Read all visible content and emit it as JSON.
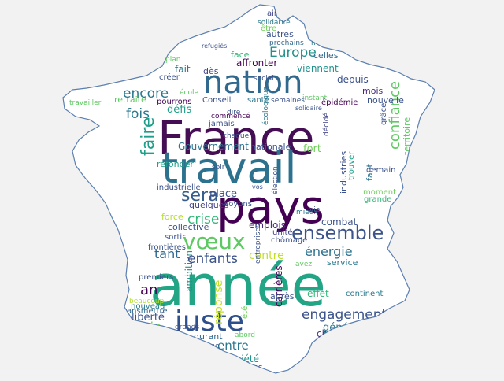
{
  "colors": {
    "background": "#f2f2f2",
    "map_fill": "#ffffff",
    "map_outline": "#5b7fb0"
  },
  "words": [
    {
      "text": "France",
      "color": "#450d54"
    },
    {
      "text": "année",
      "color": "#21a585"
    },
    {
      "text": "travail",
      "color": "#2c728e"
    },
    {
      "text": "pays",
      "color": "#440154"
    },
    {
      "text": "nation",
      "color": "#31688e"
    },
    {
      "text": "juste",
      "color": "#2d4f8c"
    },
    {
      "text": "vœux",
      "color": "#5ec962"
    },
    {
      "text": "ensemble",
      "color": "#3b528b"
    },
    {
      "text": "engagement",
      "color": "#3b528b"
    },
    {
      "text": "Europe",
      "color": "#21918c"
    },
    {
      "text": "confiance",
      "color": "#5ec962"
    },
    {
      "text": "sera",
      "color": "#365d8d"
    },
    {
      "text": "faire",
      "color": "#1f9e89"
    },
    {
      "text": "fois",
      "color": "#2a788e"
    },
    {
      "text": "encore",
      "color": "#2a788e"
    },
    {
      "text": "crise",
      "color": "#35b779"
    },
    {
      "text": "énergie",
      "color": "#2c728e"
    },
    {
      "text": "enfants",
      "color": "#3b528b"
    },
    {
      "text": "contre",
      "color": "#c2df23"
    },
    {
      "text": "tant",
      "color": "#31688e"
    },
    {
      "text": "an",
      "color": "#440154"
    },
    {
      "text": "entre",
      "color": "#2a788e"
    },
    {
      "text": "prix",
      "color": "#6ece58"
    },
    {
      "text": "liberté",
      "color": "#3b528b"
    },
    {
      "text": "chacun",
      "color": "#472c7a"
    },
    {
      "text": "génération",
      "color": "#2a788e"
    },
    {
      "text": "société",
      "color": "#21918c"
    },
    {
      "text": "aurons",
      "color": "#414487"
    },
    {
      "text": "durant",
      "color": "#31688e"
    },
    {
      "text": "Gouvernement",
      "color": "#2c728e"
    },
    {
      "text": "nationale",
      "color": "#3b528b"
    },
    {
      "text": "fort",
      "color": "#6ece58"
    },
    {
      "text": "depuis",
      "color": "#3b528b"
    },
    {
      "text": "mois",
      "color": "#482878"
    },
    {
      "text": "autres",
      "color": "#3b528b"
    },
    {
      "text": "face",
      "color": "#35b779"
    },
    {
      "text": "affronter",
      "color": "#440154"
    },
    {
      "text": "celles",
      "color": "#31688e"
    },
    {
      "text": "viennent",
      "color": "#21918c"
    },
    {
      "text": "dès",
      "color": "#414487"
    },
    {
      "text": "fait",
      "color": "#2a788e"
    },
    {
      "text": "défis",
      "color": "#1f9e89"
    },
    {
      "text": "protéger",
      "color": "#2a788e"
    },
    {
      "text": "retraite",
      "color": "#5ec962"
    },
    {
      "text": "refonder",
      "color": "#1f9e89"
    },
    {
      "text": "place",
      "color": "#3b528b"
    },
    {
      "text": "quelques",
      "color": "#414487"
    },
    {
      "text": "force",
      "color": "#b5de2b"
    },
    {
      "text": "collective",
      "color": "#3b528b"
    },
    {
      "text": "emplois",
      "color": "#482878"
    },
    {
      "text": "combat",
      "color": "#3b528b"
    },
    {
      "text": "service",
      "color": "#2a788e"
    },
    {
      "text": "effet",
      "color": "#35b779"
    },
    {
      "text": "industries",
      "color": "#3b528b"
    },
    {
      "text": "faut",
      "color": "#2c728e"
    },
    {
      "text": "grâce",
      "color": "#3b528b"
    },
    {
      "text": "territoire",
      "color": "#5ec962"
    },
    {
      "text": "nouvelle",
      "color": "#3b528b"
    },
    {
      "text": "être",
      "color": "#6ece58"
    },
    {
      "text": "ainsi",
      "color": "#414487"
    },
    {
      "text": "solidarité",
      "color": "#2a788e"
    },
    {
      "text": "prochains",
      "color": "#31688e"
    },
    {
      "text": "mois",
      "color": "#2a788e"
    },
    {
      "text": "réponse",
      "color": "#c2df23"
    },
    {
      "text": "ambition",
      "color": "#21918c"
    },
    {
      "text": "carrières",
      "color": "#440154"
    },
    {
      "text": "après",
      "color": "#3b528b"
    },
    {
      "text": "été",
      "color": "#6ece58"
    },
    {
      "text": "frontières",
      "color": "#3b528b"
    },
    {
      "text": "sortir",
      "color": "#3b528b"
    },
    {
      "text": "premiers",
      "color": "#3b528b"
    },
    {
      "text": "nouveau",
      "color": "#2a788e"
    },
    {
      "text": "transmettre",
      "color": "#31688e"
    },
    {
      "text": "beaucoup",
      "color": "#b5de2b"
    },
    {
      "text": "réforme",
      "color": "#3b528b"
    },
    {
      "text": "continent",
      "color": "#2a788e"
    },
    {
      "text": "continuons",
      "color": "#3b528b"
    },
    {
      "text": "serons",
      "color": "#3b528b"
    },
    {
      "text": "chômage",
      "color": "#3b528b"
    },
    {
      "text": "unité",
      "color": "#414487"
    },
    {
      "text": "industrielle",
      "color": "#3b528b"
    },
    {
      "text": "soyons",
      "color": "#3b528b"
    },
    {
      "text": "soir",
      "color": "#3b528b"
    },
    {
      "text": "moment",
      "color": "#6ece58"
    },
    {
      "text": "grande",
      "color": "#35b779"
    },
    {
      "text": "trouver",
      "color": "#1f9e89"
    },
    {
      "text": "demain",
      "color": "#3b528b"
    },
    {
      "text": "vie",
      "color": "#3b528b"
    },
    {
      "text": "Conseil",
      "color": "#3b528b"
    },
    {
      "text": "santé",
      "color": "#2a788e"
    },
    {
      "text": "semaines",
      "color": "#3b528b"
    },
    {
      "text": "instant",
      "color": "#5ec962"
    },
    {
      "text": "épidémie",
      "color": "#440154"
    },
    {
      "text": "pourrons",
      "color": "#440154"
    },
    {
      "text": "créer",
      "color": "#3b528b"
    },
    {
      "text": "travailler",
      "color": "#5ec962"
    },
    {
      "text": "plan",
      "color": "#5ec962"
    },
    {
      "text": "école",
      "color": "#5ec962"
    },
    {
      "text": "jamais",
      "color": "#3b528b"
    },
    {
      "text": "commencé",
      "color": "#440154"
    },
    {
      "text": "chaque",
      "color": "#3b528b"
    },
    {
      "text": "décidé",
      "color": "#414487"
    },
    {
      "text": "écologique",
      "color": "#2a788e"
    },
    {
      "text": "social",
      "color": "#3b528b"
    },
    {
      "text": "avoir",
      "color": "#35b779"
    },
    {
      "text": "abord",
      "color": "#5ec962"
    },
    {
      "text": "trop",
      "color": "#2a788e"
    },
    {
      "text": "grands",
      "color": "#3b528b"
    },
    {
      "text": "avez",
      "color": "#5ec962"
    },
    {
      "text": "entreprises",
      "color": "#3b528b"
    },
    {
      "text": "européen",
      "color": "#3b528b"
    },
    {
      "text": "refugiés",
      "color": "#3b528b"
    },
    {
      "text": "solidaire",
      "color": "#3b528b"
    },
    {
      "text": "dire",
      "color": "#3b528b"
    },
    {
      "text": "élection",
      "color": "#3b528b"
    },
    {
      "text": "mieux",
      "color": "#2a788e"
    },
    {
      "text": "vos",
      "color": "#3b528b"
    }
  ]
}
